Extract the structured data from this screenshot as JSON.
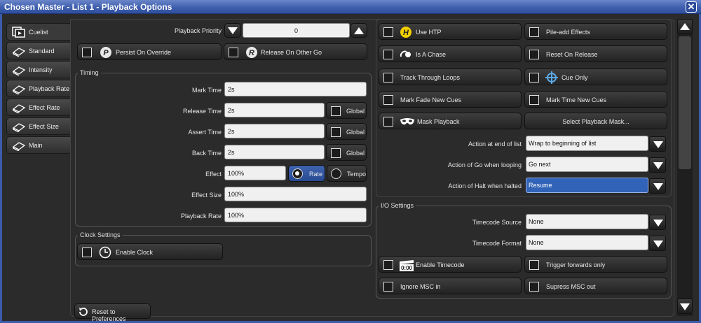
{
  "window": {
    "title": "Chosen Master - List 1 - Playback Options",
    "close_glyph": "✕"
  },
  "tabs": [
    {
      "label": "Cuelist",
      "icon": "cuelist-icon",
      "active": true
    },
    {
      "label": "Standard",
      "icon": "standard-icon"
    },
    {
      "label": "Intensity",
      "icon": "intensity-icon"
    },
    {
      "label": "Playback Rate",
      "icon": "playback-rate-icon"
    },
    {
      "label": "Effect Rate",
      "icon": "effect-rate-icon"
    },
    {
      "label": "Effect Size",
      "icon": "effect-size-icon"
    },
    {
      "label": "Main",
      "icon": "main-icon"
    }
  ],
  "priority": {
    "label": "Playback Priority",
    "value": "0"
  },
  "top_options": {
    "persist": "Persist On Override",
    "release_other": "Release On Other Go"
  },
  "timing": {
    "title": "Timing",
    "mark_time": {
      "label": "Mark Time",
      "value": "2s"
    },
    "release_time": {
      "label": "Release Time",
      "value": "2s"
    },
    "assert_time": {
      "label": "Assert Time",
      "value": "2s"
    },
    "back_time": {
      "label": "Back Time",
      "value": "2s"
    },
    "effect": {
      "label": "Effect",
      "value": "100%",
      "rate": "Rate",
      "tempo": "Tempo"
    },
    "effect_size": {
      "label": "Effect Size",
      "value": "100%"
    },
    "playback_rate": {
      "label": "Playback Rate",
      "value": "100%"
    },
    "global": "Global"
  },
  "clock": {
    "title": "Clock Settings",
    "enable": "Enable Clock"
  },
  "reset": "Reset to Preferences",
  "right_options": {
    "use_htp": "Use HTP",
    "pile_add": "Pile-add Effects",
    "is_chase": "Is A Chase",
    "reset_release": "Reset On Release",
    "track_loops": "Track Through Loops",
    "cue_only": "Cue Only",
    "mark_fade": "Mark Fade New Cues",
    "mark_time_new": "Mark Time New Cues",
    "mask_playback": "Mask Playback",
    "select_mask": "Select Playback Mask..."
  },
  "actions": {
    "end_of_list": {
      "label": "Action at end of list",
      "value": "Wrap to beginning of list"
    },
    "go_looping": {
      "label": "Action of Go when looping",
      "value": "Go next"
    },
    "halt_halted": {
      "label": "Action of Halt when halted",
      "value": "Resume"
    }
  },
  "io": {
    "title": "I/O Settings",
    "tc_source": {
      "label": "Timecode Source",
      "value": "None"
    },
    "tc_format": {
      "label": "Timecode Format",
      "value": "None"
    },
    "enable_tc": "Enable Timecode",
    "trigger_fwd": "Trigger forwards only",
    "ignore_msc": "Ignore MSC in",
    "supress_msc": "Supress MSC out",
    "tc_icon_text": "0:00"
  },
  "icon_letters": {
    "persist": "P",
    "release": "R",
    "htp": "H"
  },
  "colors": {
    "accent": "#3163b8",
    "title_bar": "#3f5fae",
    "htp_badge": "#f2d000"
  }
}
